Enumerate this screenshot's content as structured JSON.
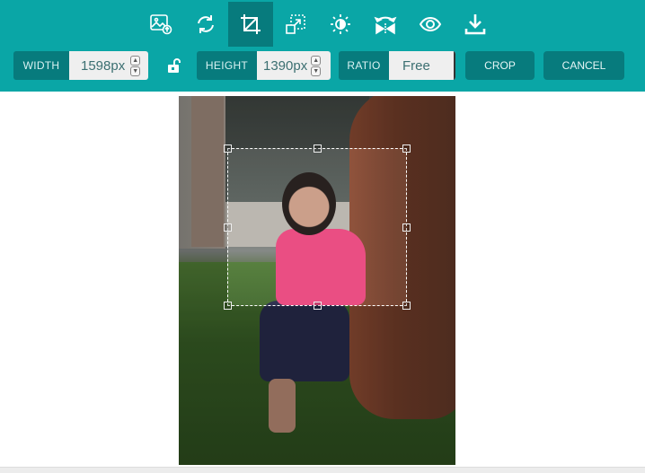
{
  "toolbar": {
    "tools": [
      {
        "name": "upload-image",
        "icon": "image-upload-icon",
        "active": false
      },
      {
        "name": "rotate",
        "icon": "rotate-icon",
        "active": false
      },
      {
        "name": "crop",
        "icon": "crop-icon",
        "active": true
      },
      {
        "name": "resize",
        "icon": "resize-icon",
        "active": false
      },
      {
        "name": "brightness",
        "icon": "brightness-icon",
        "active": false
      },
      {
        "name": "flip",
        "icon": "flip-icon",
        "active": false
      },
      {
        "name": "preview",
        "icon": "eye-icon",
        "active": false
      },
      {
        "name": "download",
        "icon": "download-icon",
        "active": false
      }
    ],
    "width": {
      "label": "WIDTH",
      "value": "1598px"
    },
    "height": {
      "label": "HEIGHT",
      "value": "1390px"
    },
    "ratio": {
      "label": "RATIO",
      "value": "Free"
    },
    "crop_label": "CROP",
    "cancel_label": "CANCEL",
    "lock_icon": "unlock-icon",
    "colors": {
      "bar": "#0aa6a6",
      "dark": "#077b7d",
      "input_bg": "#efefef"
    }
  },
  "canvas": {
    "image_alt": "Child in pink jacket standing by a tree trunk on grass",
    "crop_selection": {
      "handles": 8
    }
  }
}
